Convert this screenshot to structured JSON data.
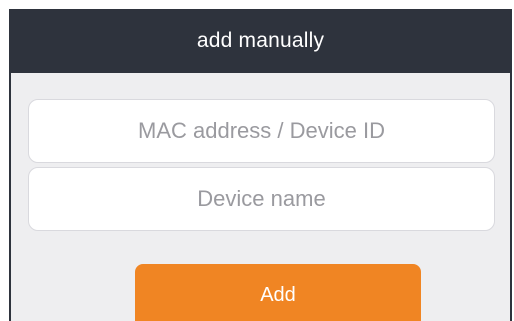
{
  "dialog": {
    "title": "add manually"
  },
  "fields": {
    "mac": {
      "placeholder": "MAC address / Device ID",
      "value": ""
    },
    "name": {
      "placeholder": "Device name",
      "value": ""
    }
  },
  "actions": {
    "add_label": "Add"
  },
  "colors": {
    "header_bg": "#2e333d",
    "body_bg": "#eeeef0",
    "accent": "#f08523"
  }
}
